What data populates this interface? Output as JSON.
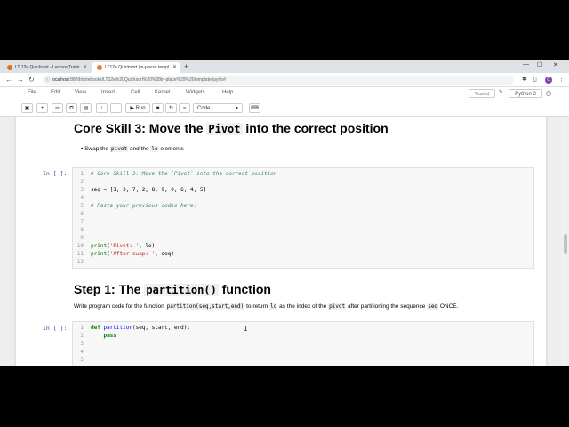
{
  "browser": {
    "tabs": [
      {
        "title": "LT 12e Quicksort - Lecture Traini",
        "favicon_color": "#e8710a"
      },
      {
        "title": "LT12e Quicksort (in-place) templ",
        "favicon_color": "#f37726"
      }
    ],
    "new_tab": "+",
    "url_host": "localhost",
    "url_rest": ":8889/notebooks/LT12e%20Quicksort%20%28in-place%29%20template.ipynb#",
    "avatar_letter": "C"
  },
  "jupyter": {
    "menu": [
      "File",
      "Edit",
      "View",
      "Insert",
      "Cell",
      "Kernel",
      "Widgets",
      "Help"
    ],
    "trusted": "Trusted",
    "kernel_name": "Python 3",
    "run_label": "Run",
    "cell_type": "Code"
  },
  "notebook": {
    "heading1": {
      "pre": "Core Skill 3: Move the ",
      "code": "Pivot",
      "post": " into the correct position"
    },
    "bullet": {
      "pre": "Swap the ",
      "code1": "pivot",
      "mid": " and the ",
      "code2": "lo",
      "post": " elements"
    },
    "prompt1": "In [ ]:",
    "cell1": [
      {
        "n": "1",
        "t": "# Core Skill 3: Move the `Pivot` into the correct position"
      },
      {
        "n": "2",
        "t": ""
      },
      {
        "n": "3",
        "t": "seq = [1, 3, 7, 2, 8, 9, 0, 6, 4, 5]"
      },
      {
        "n": "4",
        "t": ""
      },
      {
        "n": "5",
        "t": "# Paste your previous codes here:"
      },
      {
        "n": "6",
        "t": ""
      },
      {
        "n": "7",
        "t": ""
      },
      {
        "n": "8",
        "t": ""
      },
      {
        "n": "9",
        "t": ""
      },
      {
        "n": "10",
        "t": "print('Pivot: ', lo)"
      },
      {
        "n": "11",
        "t": "print('After swap: ', seq)"
      },
      {
        "n": "12",
        "t": ""
      }
    ],
    "heading2": {
      "pre": "Step 1: The ",
      "code": "partition()",
      "post": " function"
    },
    "para": {
      "p1": "Write program code for the function ",
      "c1": "partition(seq,start,end)",
      "p2": " to return ",
      "c2": "lo",
      "p3": " as the index of the ",
      "c3": "pivot",
      "p4": " after partitioning the sequence ",
      "c4": "seq",
      "p5": " ONCE."
    },
    "prompt2": "In [ ]:",
    "cell2": [
      {
        "n": "1",
        "t": "def partition(seq, start, end):"
      },
      {
        "n": "2",
        "t": "    pass"
      },
      {
        "n": "3",
        "t": ""
      },
      {
        "n": "4",
        "t": ""
      },
      {
        "n": "5",
        "t": ""
      }
    ]
  }
}
